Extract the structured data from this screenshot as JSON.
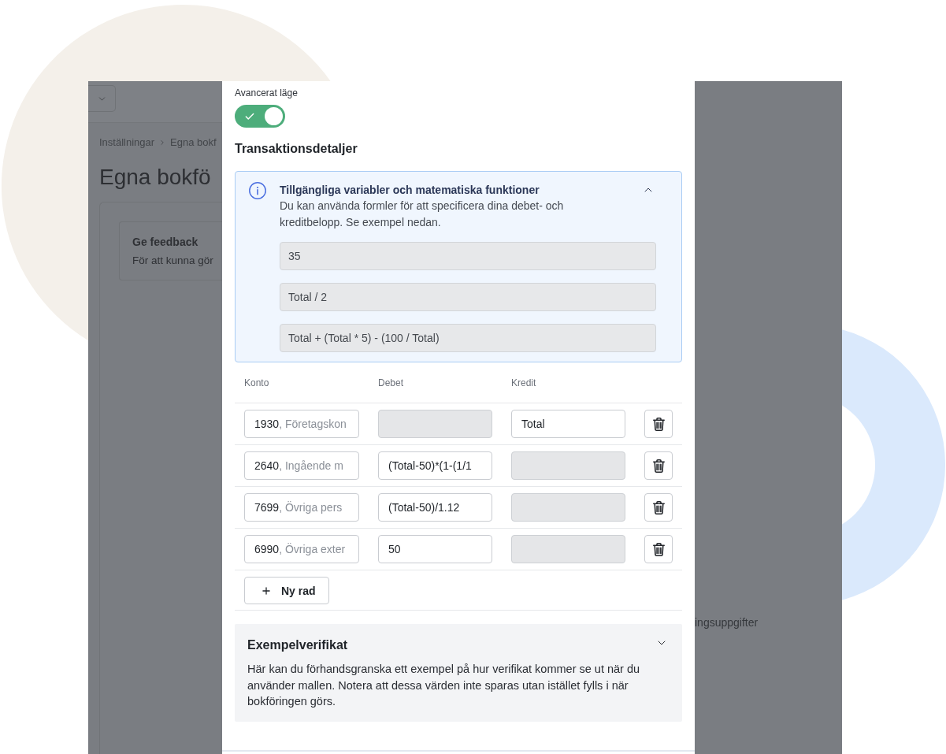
{
  "backdrop": {
    "breadcrumb": [
      "Inställningar",
      "Egna bokf"
    ],
    "title": "Egna bokfö",
    "feedback_card": {
      "title": "Ge feedback",
      "text": "För att kunna gör"
    },
    "side_text": "ingsuppgifter"
  },
  "modal": {
    "advanced_mode": {
      "label": "Avancerat läge",
      "on": true
    },
    "section_title": "Transaktionsdetaljer",
    "info_panel": {
      "title": "Tillgängliga variabler och matematiska funktioner",
      "description": "Du kan använda formler för att specificera dina debet- och kreditbelopp. Se exempel nedan.",
      "expanded": true,
      "examples": [
        "35",
        "Total / 2",
        "Total + (Total * 5) - (100 / Total)"
      ]
    },
    "table": {
      "columns": [
        "Konto",
        "Debet",
        "Kredit"
      ],
      "rows": [
        {
          "account_number": "1930",
          "account_name": ", Företagskon",
          "debit": {
            "disabled": true
          },
          "credit": {
            "value": "Total",
            "disabled": false
          }
        },
        {
          "account_number": "2640",
          "account_name": ", Ingående m",
          "debit": {
            "value": "(Total-50)*(1-(1/1",
            "disabled": false
          },
          "credit": {
            "disabled": true
          }
        },
        {
          "account_number": "7699",
          "account_name": ", Övriga pers",
          "debit": {
            "value": "(Total-50)/1.12",
            "disabled": false
          },
          "credit": {
            "disabled": true
          }
        },
        {
          "account_number": "6990",
          "account_name": ", Övriga exter",
          "debit": {
            "value": "50",
            "disabled": false
          },
          "credit": {
            "disabled": true
          }
        }
      ]
    },
    "add_row_button": "Ny rad",
    "example_section": {
      "title": "Exempelverifikat",
      "description": "Här kan du förhandsgranska ett exempel på hur verifikat kommer se ut när du använder mallen. Notera att dessa värden inte sparas utan istället fylls i när bokföringen görs.",
      "expanded": false
    }
  }
}
